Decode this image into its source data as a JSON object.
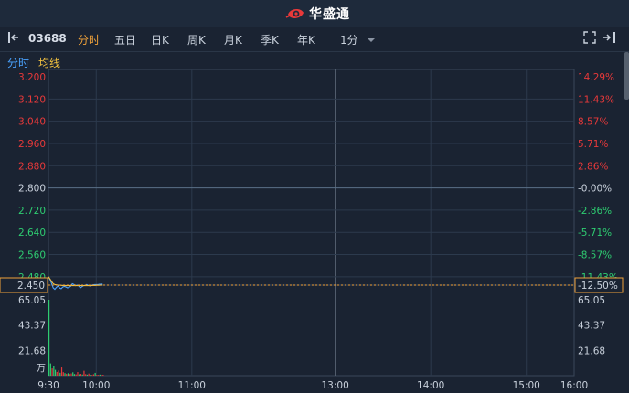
{
  "app": {
    "brand": "华盛通"
  },
  "toolbar": {
    "code": "03688",
    "tabs": [
      "分时",
      "五日",
      "日K",
      "周K",
      "月K",
      "季K",
      "年K"
    ],
    "active_tab": 0,
    "interval": "1分"
  },
  "subtabs": {
    "intraday": "分时",
    "avg": "均线"
  },
  "colors": {
    "up": "#e8393a",
    "down": "#2ecc71",
    "neutral": "#c9d1dc",
    "accent": "#f0a23a",
    "price_line": "#4aa3ff",
    "avg_line": "#f0c040",
    "bg": "#1a2332",
    "grid": "#2c3a4d"
  },
  "chart_data": {
    "type": "line",
    "reference_price": 2.8,
    "current_price_label": "2.450",
    "current_pct_label": "-12.50%",
    "price_ticks": [
      {
        "price": 3.2,
        "label": "3.200",
        "pct": "14.29%"
      },
      {
        "price": 3.12,
        "label": "3.120",
        "pct": "11.43%"
      },
      {
        "price": 3.04,
        "label": "3.040",
        "pct": "8.57%"
      },
      {
        "price": 2.96,
        "label": "2.960",
        "pct": "5.71%"
      },
      {
        "price": 2.88,
        "label": "2.880",
        "pct": "2.86%"
      },
      {
        "price": 2.8,
        "label": "2.800",
        "pct": "-0.00%"
      },
      {
        "price": 2.72,
        "label": "2.720",
        "pct": "-2.86%"
      },
      {
        "price": 2.64,
        "label": "2.640",
        "pct": "-5.71%"
      },
      {
        "price": 2.56,
        "label": "2.560",
        "pct": "-8.57%"
      },
      {
        "price": 2.48,
        "label": "2.480",
        "pct": "-11.43%"
      }
    ],
    "price_range": [
      2.45,
      3.2
    ],
    "volume_ticks": [
      {
        "value": 65.05,
        "label": "65.05"
      },
      {
        "value": 43.37,
        "label": "43.37"
      },
      {
        "value": 21.68,
        "label": "21.68"
      }
    ],
    "volume_unit": "万",
    "volume_max": 65.05,
    "time_ticks": [
      "9:30",
      "10:00",
      "11:00",
      "13:00",
      "14:00",
      "15:00",
      "16:00"
    ],
    "session_minutes": 330,
    "price_series": [
      [
        0,
        2.48
      ],
      [
        1,
        2.47
      ],
      [
        2,
        2.455
      ],
      [
        3,
        2.44
      ],
      [
        4,
        2.435
      ],
      [
        5,
        2.442
      ],
      [
        6,
        2.447
      ],
      [
        7,
        2.44
      ],
      [
        8,
        2.437
      ],
      [
        9,
        2.443
      ],
      [
        10,
        2.445
      ],
      [
        11,
        2.443
      ],
      [
        12,
        2.44
      ],
      [
        13,
        2.442
      ],
      [
        14,
        2.446
      ],
      [
        15,
        2.455
      ],
      [
        16,
        2.452
      ],
      [
        17,
        2.448
      ],
      [
        18,
        2.45
      ],
      [
        19,
        2.447
      ],
      [
        20,
        2.44
      ],
      [
        21,
        2.444
      ],
      [
        22,
        2.448
      ],
      [
        23,
        2.449
      ],
      [
        24,
        2.452
      ],
      [
        25,
        2.449
      ],
      [
        26,
        2.447
      ],
      [
        27,
        2.449
      ],
      [
        28,
        2.451
      ],
      [
        29,
        2.452
      ],
      [
        30,
        2.452
      ],
      [
        31,
        2.452
      ],
      [
        32,
        2.453
      ],
      [
        33,
        2.453
      ],
      [
        34,
        2.454
      ]
    ],
    "avg_series": [
      [
        0,
        2.48
      ],
      [
        1,
        2.472
      ],
      [
        2,
        2.463
      ],
      [
        3,
        2.455
      ],
      [
        4,
        2.452
      ],
      [
        5,
        2.451
      ],
      [
        6,
        2.45
      ],
      [
        8,
        2.449
      ],
      [
        10,
        2.448
      ],
      [
        14,
        2.448
      ],
      [
        18,
        2.448
      ],
      [
        22,
        2.448
      ],
      [
        26,
        2.448
      ],
      [
        30,
        2.449
      ],
      [
        34,
        2.45
      ]
    ],
    "volume_series": [
      [
        0,
        65.05
      ],
      [
        1,
        10.5
      ],
      [
        2,
        6.2
      ],
      [
        3,
        8.1
      ],
      [
        4,
        5.0
      ],
      [
        5,
        3.2
      ],
      [
        6,
        4.5
      ],
      [
        7,
        2.5
      ],
      [
        8,
        7.0
      ],
      [
        9,
        3.0
      ],
      [
        10,
        2.2
      ],
      [
        11,
        1.6
      ],
      [
        12,
        2.1
      ],
      [
        13,
        1.4
      ],
      [
        14,
        1.9
      ],
      [
        15,
        2.9
      ],
      [
        16,
        1.4
      ],
      [
        17,
        1.1
      ],
      [
        18,
        3.1
      ],
      [
        19,
        1.2
      ],
      [
        20,
        1.5
      ],
      [
        21,
        1.0
      ],
      [
        22,
        4.2
      ],
      [
        23,
        1.3
      ],
      [
        24,
        0.9
      ],
      [
        25,
        1.8
      ],
      [
        26,
        0.8
      ],
      [
        27,
        0.6
      ],
      [
        28,
        1.2
      ],
      [
        29,
        2.4
      ],
      [
        30,
        0.7
      ],
      [
        31,
        0.6
      ],
      [
        32,
        0.9
      ],
      [
        33,
        0.5
      ],
      [
        34,
        0.8
      ]
    ],
    "volume_up": [
      0,
      0,
      1,
      0,
      0,
      1,
      1,
      0,
      1,
      1,
      0,
      1,
      0,
      1,
      1,
      0,
      0,
      1,
      1,
      0,
      1,
      0,
      1,
      1,
      0,
      1,
      0,
      1,
      1,
      0,
      1,
      1,
      0,
      1,
      1
    ]
  }
}
